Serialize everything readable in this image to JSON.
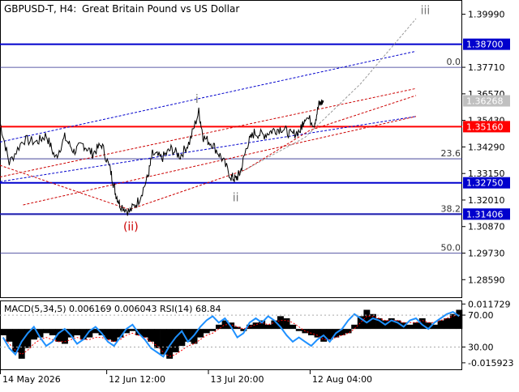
{
  "header": {
    "symbol": "GBPUSD-T, H4:",
    "description": "Great Britain Pound vs US Dollar"
  },
  "chart_data": {
    "type": "line",
    "main": {
      "ylim": [
        1.278,
        1.406
      ],
      "ticks": [
        "1.39990",
        "1.38700",
        "1.37710",
        "1.36570",
        "1.36268",
        "1.35430",
        "1.35160",
        "1.34290",
        "1.33150",
        "1.32750",
        "1.32010",
        "1.31406",
        "1.30870",
        "1.29730",
        "1.28590"
      ],
      "tick_values": [
        1.3999,
        1.387,
        1.3771,
        1.3657,
        1.36268,
        1.3543,
        1.3516,
        1.3429,
        1.3315,
        1.3275,
        1.3201,
        1.31406,
        1.3087,
        1.2973,
        1.2859
      ],
      "current_price": {
        "value": 1.36268,
        "label": "1.36268"
      },
      "levels": [
        {
          "value": 1.387,
          "label": "1.38700",
          "color": "#0000cd",
          "width": 2
        },
        {
          "value": 1.3516,
          "label": "1.35160",
          "color": "#ff0000",
          "width": 2
        },
        {
          "value": 1.3275,
          "label": "1.32750",
          "color": "#0000cd",
          "width": 2
        },
        {
          "value": 1.31406,
          "label": "1.31406",
          "color": "#0000cd",
          "width": 2
        }
      ],
      "fibonacci": [
        {
          "value": 1.3771,
          "label": "0.0"
        },
        {
          "value": 1.3378,
          "label": "23.6"
        },
        {
          "value": 1.31406,
          "label": "38.2"
        },
        {
          "value": 1.2973,
          "label": "50.0"
        }
      ],
      "wave_labels": [
        {
          "label": "iii",
          "x": 0.92,
          "y": 1.4,
          "color": "#777777"
        },
        {
          "label": "i",
          "x": 0.426,
          "y": 1.3618,
          "color": "#777777"
        },
        {
          "label": "ii",
          "x": 0.51,
          "y": 1.3195,
          "color": "#777777"
        },
        {
          "label": "(ii)",
          "x": 0.283,
          "y": 1.307,
          "color": "#cc0000"
        }
      ],
      "price": {
        "x": [
          0.0,
          0.02,
          0.05,
          0.08,
          0.1,
          0.12,
          0.14,
          0.16,
          0.18,
          0.2,
          0.22,
          0.24,
          0.25,
          0.26,
          0.28,
          0.3,
          0.32,
          0.33,
          0.35,
          0.37,
          0.39,
          0.41,
          0.43,
          0.44,
          0.46,
          0.48,
          0.5,
          0.51,
          0.52,
          0.535,
          0.55,
          0.57,
          0.59,
          0.61,
          0.63,
          0.65,
          0.66,
          0.68,
          0.69,
          0.7
        ],
        "y": [
          1.3535,
          1.336,
          1.346,
          1.345,
          1.348,
          1.338,
          1.347,
          1.341,
          1.344,
          1.34,
          1.344,
          1.332,
          1.323,
          1.318,
          1.315,
          1.32,
          1.33,
          1.34,
          1.338,
          1.342,
          1.339,
          1.345,
          1.358,
          1.347,
          1.344,
          1.338,
          1.33,
          1.329,
          1.332,
          1.344,
          1.349,
          1.348,
          1.35,
          1.351,
          1.348,
          1.35,
          1.356,
          1.353,
          1.361,
          1.3627
        ]
      },
      "projections": [
        {
          "name": "blue channel top",
          "color": "#0000cd",
          "x": [
            0.0,
            0.9
          ],
          "y": [
            1.345,
            1.384
          ]
        },
        {
          "name": "dashed blue channel low",
          "color": "#0000cd",
          "x": [
            0.0,
            0.9
          ],
          "y": [
            1.328,
            1.356
          ]
        },
        {
          "name": "red channel 1",
          "color": "#cc0000",
          "x": [
            0.0,
            0.9
          ],
          "y": [
            1.33,
            1.368
          ]
        },
        {
          "name": "red channel 2",
          "color": "#cc0000",
          "x": [
            0.05,
            0.9
          ],
          "y": [
            1.318,
            1.356
          ]
        },
        {
          "name": "red wave path",
          "color": "#cc0000",
          "x": [
            0.0,
            0.28,
            0.53,
            0.67,
            0.9
          ],
          "y": [
            1.335,
            1.316,
            1.333,
            1.35,
            1.365
          ]
        },
        {
          "name": "grey projection",
          "color": "#999999",
          "x": [
            0.52,
            0.66,
            0.78,
            0.9
          ],
          "y": [
            1.332,
            1.347,
            1.37,
            1.398
          ]
        }
      ]
    },
    "macd": {
      "label": "MACD(5,34,5) 0.006169 0.006043 RSI(14) 68.84",
      "ylim": [
        -0.019,
        0.013
      ],
      "ticks": [
        "0.011729",
        "70.00",
        "30.00",
        "-0.015923"
      ],
      "tick_values": [
        0.011729,
        0.0065,
        -0.0085,
        -0.015923
      ],
      "histogram": [
        -0.003,
        -0.006,
        -0.011,
        -0.014,
        -0.009,
        -0.005,
        -0.004,
        -0.002,
        -0.003,
        -0.006,
        -0.007,
        -0.004,
        -0.003,
        -0.005,
        -0.004,
        -0.002,
        -0.003,
        -0.005,
        -0.006,
        -0.004,
        -0.002,
        -0.001,
        -0.003,
        -0.004,
        -0.006,
        -0.009,
        -0.012,
        -0.014,
        -0.011,
        -0.008,
        -0.006,
        -0.007,
        -0.004,
        -0.002,
        -0.001,
        0.002,
        0.004,
        0.003,
        0.001,
        -0.001,
        0.002,
        0.003,
        0.004,
        0.002,
        0.004,
        0.006,
        0.005,
        0.002,
        -0.001,
        -0.002,
        -0.003,
        -0.004,
        -0.006,
        -0.005,
        -0.004,
        -0.003,
        -0.002,
        0.002,
        0.006,
        0.009,
        0.007,
        0.005,
        0.004,
        0.005,
        0.004,
        0.003,
        0.002,
        0.003,
        0.005,
        0.003,
        0.002,
        0.004,
        0.005,
        0.007,
        0.009
      ],
      "signal": [
        -0.004,
        -0.007,
        -0.01,
        -0.012,
        -0.01,
        -0.007,
        -0.005,
        -0.004,
        -0.005,
        -0.006,
        -0.006,
        -0.005,
        -0.004,
        -0.005,
        -0.005,
        -0.004,
        -0.004,
        -0.005,
        -0.006,
        -0.005,
        -0.003,
        -0.002,
        -0.003,
        -0.004,
        -0.006,
        -0.008,
        -0.011,
        -0.013,
        -0.012,
        -0.01,
        -0.008,
        -0.007,
        -0.005,
        -0.003,
        -0.002,
        0.0,
        0.002,
        0.002,
        0.001,
        0.0,
        0.001,
        0.002,
        0.003,
        0.002,
        0.003,
        0.004,
        0.004,
        0.003,
        0.001,
        -0.001,
        -0.002,
        -0.003,
        -0.005,
        -0.005,
        -0.004,
        -0.003,
        -0.002,
        0.0,
        0.003,
        0.006,
        0.006,
        0.005,
        0.004,
        0.004,
        0.004,
        0.003,
        0.003,
        0.003,
        0.004,
        0.003,
        0.003,
        0.004,
        0.005,
        0.006,
        0.007
      ],
      "rsi": [
        -0.004,
        -0.009,
        -0.012,
        -0.006,
        -0.002,
        0.001,
        -0.004,
        -0.008,
        -0.006,
        -0.002,
        0.0,
        -0.003,
        -0.007,
        -0.005,
        -0.001,
        0.001,
        -0.002,
        -0.006,
        -0.008,
        -0.004,
        0.0,
        0.002,
        -0.002,
        -0.005,
        -0.009,
        -0.011,
        -0.013,
        -0.008,
        -0.004,
        -0.001,
        -0.006,
        -0.003,
        0.001,
        0.004,
        0.006,
        0.003,
        0.005,
        0.001,
        -0.004,
        -0.002,
        0.003,
        0.005,
        0.003,
        0.006,
        0.004,
        0.001,
        -0.003,
        -0.006,
        -0.004,
        -0.006,
        -0.008,
        -0.005,
        -0.003,
        -0.006,
        -0.002,
        0.0,
        0.004,
        0.007,
        0.005,
        0.003,
        0.005,
        0.004,
        0.002,
        0.004,
        0.003,
        0.001,
        0.004,
        0.005,
        0.002,
        0.0,
        0.003,
        0.005,
        0.007,
        0.008,
        0.006
      ]
    },
    "xaxis": {
      "labels": [
        "14 May 2026",
        "12 Jun 12:00",
        "13 Jul 20:00",
        "12 Aug 04:00"
      ],
      "positions": [
        0.0,
        0.23,
        0.45,
        0.67
      ]
    }
  }
}
